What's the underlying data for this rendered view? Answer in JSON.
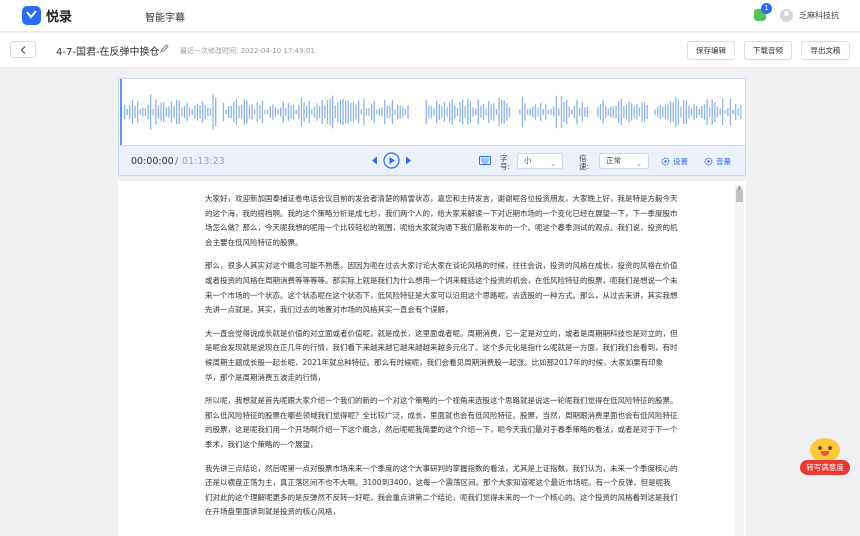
{
  "header": {
    "logo_text": "悦录",
    "app_title": "智能字幕",
    "notification_count": "1",
    "username": "乏麻科技抗"
  },
  "file": {
    "name": "4-7-国君-在反弹中换仓",
    "modified": "最近一次修改时间: 2022-04-10 17:49:01",
    "buttons": {
      "save": "保存编辑",
      "download_audio": "下载音频",
      "export": "导出文稿"
    }
  },
  "player": {
    "current_time": "00:00:00",
    "separator": "/",
    "total_time": "01:13:23",
    "font_label": "字号:",
    "font_size": "小",
    "speed_label": "倍速:",
    "speed": "正常",
    "settings": "设置",
    "volume": "音量"
  },
  "document": {
    "paragraphs": [
      "大家好，欢迎新加国泰捕证卷电话会议目前的发会者清楚的精雪状态，嘉您和主持发言，谢谢呢各位投资朋友，大家晚上好，我是特是方毅今天的这个海，我的搭档啊。我的这个策略分析是成七杉，我们两个人的，给大家来解读一下对近期市场的一个变化已经在展望一下，下一季度股市场怎么做？那么，今天呢我想的呢用一个比较轻松的氛围，呃给大家就沟通下我们最新发布的一个。呃这个春季测试的观点。我们说，投资的机会主要在低风险特征的股票。",
      "那么，很多人其实对这个概念可能不熟悉，因因为呃在过去大家讨论大家在谈论风格的时候，往往会说，投资的风格在成长，投资的风格在价值或者投资的风格在周期消费等等等等。那实际上就是我们为什么想用一个词来概括这个投资的机会，在低风险特征的股票，呃我们是想说一个未来一个市场的一个状态。这个状态呢在这个状态下，低风险特征是大家可以沿用这个思路呢，去选股的一种方式。那么，从过去来讲，其实我想先讲一点就是，其实，我们过去的地置对市场的风格其实一直会有个误解，",
      "大一直会觉得说成长就是价值的对立面或者价值呢，就是成长，这里面或者呢。周期消费，它一定是对立的，或者是周期期科技也是对立的，但是呢会发现就是说现在正几年的行情，我们看下来越来越它越来越越来越多元化了。这个多元化是指什么呢就是一方面，我们我们会看到，有时候周期主题成长股一起长呢，2021年就总种特征。那么有时候呢，我们会看见周期消费股一起涨。比如那2017年的时候，大家如果有印象华，那个是周期消费五波走的行情，",
      "所以呢，我想就是首先呢跟大家介绍一个我们的新的一个对这个策略的一个视角来选股这个思路就是说这一轮呢我们觉得在低风险特征的股票。那么低风险特征的股票在哪些领域我们觉得呢？全比较广泛，成长，里面就也会有低风险特征。股票，当然，周期跟消费里面也会有低风险特征的股票，这是呢我们用一个开场啊介绍一下这个概念，然后呢呢我简要的这个介绍一下，呃今天我们最对于春季策略的看法，或者是对于下一个季术，我们这个策略的一个展望，",
      "我先讲三点结论，然后呢第一点对股票市场来来一个季度的这个大事研判的掌握指数的看法，尤其是上证指数，我们认为，未来一个季度核心的还是以横盘正荡为主，真正落区间不也不大啊。3100到3400，这每一个震荡区间。那个大家知道呢这个最近市场呢。有一个反弹，但是呢我们对此的这个理解呢更多的是反弹然不反转一好呢，我会重点讲第二个结论，呃我们觉得未来的一个一个核心的。这个投资的风格看到这是我们在开场盘里面讲到就是投资的核心风格，"
    ]
  },
  "feedback": {
    "label": "转写满意度"
  },
  "colors": {
    "accent": "#2a6cf6",
    "waveform": "#8fb4ea",
    "feedback": "#e83a33"
  }
}
